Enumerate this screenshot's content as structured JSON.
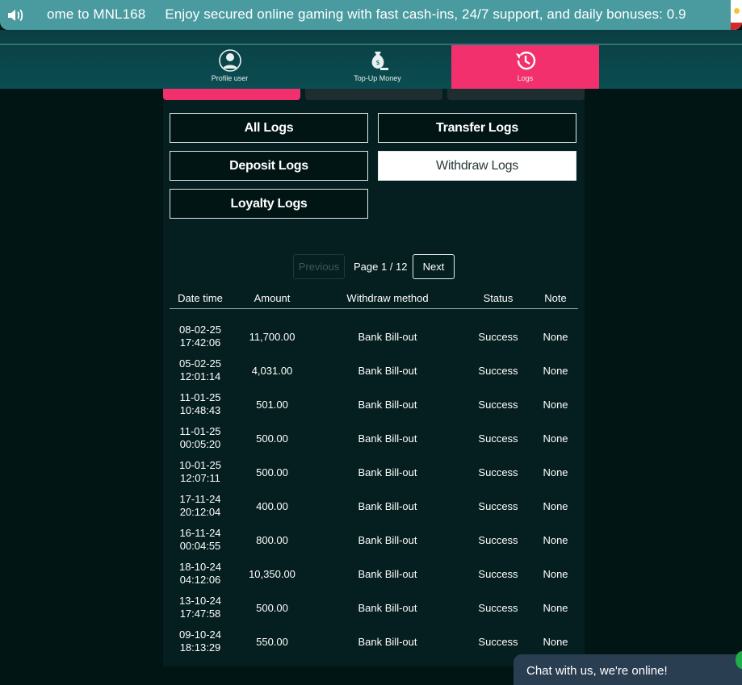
{
  "marquee": {
    "text": "ome to MNL168     Enjoy secured online gaming with fast cash-ins, 24/7 support, and daily bonuses: 0.9",
    "icon": "speaker-icon"
  },
  "nav": {
    "items": [
      {
        "label": "Profile user",
        "icon": "user-icon",
        "active": false
      },
      {
        "label": "Top-Up Money",
        "icon": "money-bag-icon",
        "active": false
      },
      {
        "label": "Logs",
        "icon": "history-icon",
        "active": true
      }
    ],
    "active_color": "#f2306d"
  },
  "log_filters": {
    "all": "All Logs",
    "transfer": "Transfer Logs",
    "deposit": "Deposit Logs",
    "withdraw": "Withdraw Logs",
    "loyalty": "Loyalty Logs",
    "active": "withdraw"
  },
  "pagination": {
    "previous": "Previous",
    "info": "Page 1 / 12",
    "next": "Next"
  },
  "table": {
    "headers": [
      "Date time",
      "Amount",
      "Withdraw method",
      "Status",
      "Note"
    ],
    "rows": [
      {
        "date": "08-02-25",
        "time": "17:42:06",
        "amount": "11,700.00",
        "method": "Bank Bill-out",
        "status": "Success",
        "note": "None"
      },
      {
        "date": "05-02-25",
        "time": "12:01:14",
        "amount": "4,031.00",
        "method": "Bank Bill-out",
        "status": "Success",
        "note": "None"
      },
      {
        "date": "11-01-25",
        "time": "10:48:43",
        "amount": "501.00",
        "method": "Bank Bill-out",
        "status": "Success",
        "note": "None"
      },
      {
        "date": "11-01-25",
        "time": "00:05:20",
        "amount": "500.00",
        "method": "Bank Bill-out",
        "status": "Success",
        "note": "None"
      },
      {
        "date": "10-01-25",
        "time": "12:07:11",
        "amount": "500.00",
        "method": "Bank Bill-out",
        "status": "Success",
        "note": "None"
      },
      {
        "date": "17-11-24",
        "time": "20:12:04",
        "amount": "400.00",
        "method": "Bank Bill-out",
        "status": "Success",
        "note": "None"
      },
      {
        "date": "16-11-24",
        "time": "00:04:55",
        "amount": "800.00",
        "method": "Bank Bill-out",
        "status": "Success",
        "note": "None"
      },
      {
        "date": "18-10-24",
        "time": "04:12:06",
        "amount": "10,350.00",
        "method": "Bank Bill-out",
        "status": "Success",
        "note": "None"
      },
      {
        "date": "13-10-24",
        "time": "17:47:58",
        "amount": "500.00",
        "method": "Bank Bill-out",
        "status": "Success",
        "note": "None"
      },
      {
        "date": "09-10-24",
        "time": "18:13:29",
        "amount": "550.00",
        "method": "Bank Bill-out",
        "status": "Success",
        "note": "None"
      }
    ]
  },
  "chat": {
    "label": "Chat with us, we're online!"
  }
}
